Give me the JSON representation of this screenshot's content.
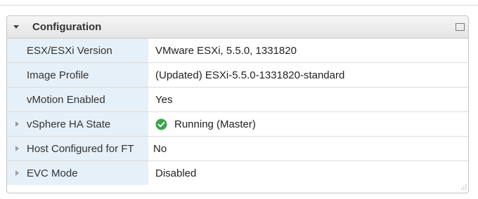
{
  "portlet": {
    "title": "Configuration",
    "expanded": true
  },
  "rows": [
    {
      "label": "ESX/ESXi Version",
      "value": "VMware ESXi, 5.5.0, 1331820",
      "expandable": false
    },
    {
      "label": "Image Profile",
      "value": "(Updated) ESXi-5.5.0-1331820-standard",
      "expandable": false
    },
    {
      "label": "vMotion Enabled",
      "value": "Yes",
      "expandable": false
    },
    {
      "label": "vSphere HA State",
      "value": "Running (Master)",
      "expandable": true,
      "status_icon": "check-circle-icon",
      "status_color": "#3aa64a"
    },
    {
      "label": "Host Configured for FT",
      "value": "No",
      "expandable": true
    },
    {
      "label": "EVC Mode",
      "value": "Disabled",
      "expandable": true
    }
  ],
  "colors": {
    "label_background": "#e6f0f8",
    "status_ok": "#3aa64a"
  }
}
